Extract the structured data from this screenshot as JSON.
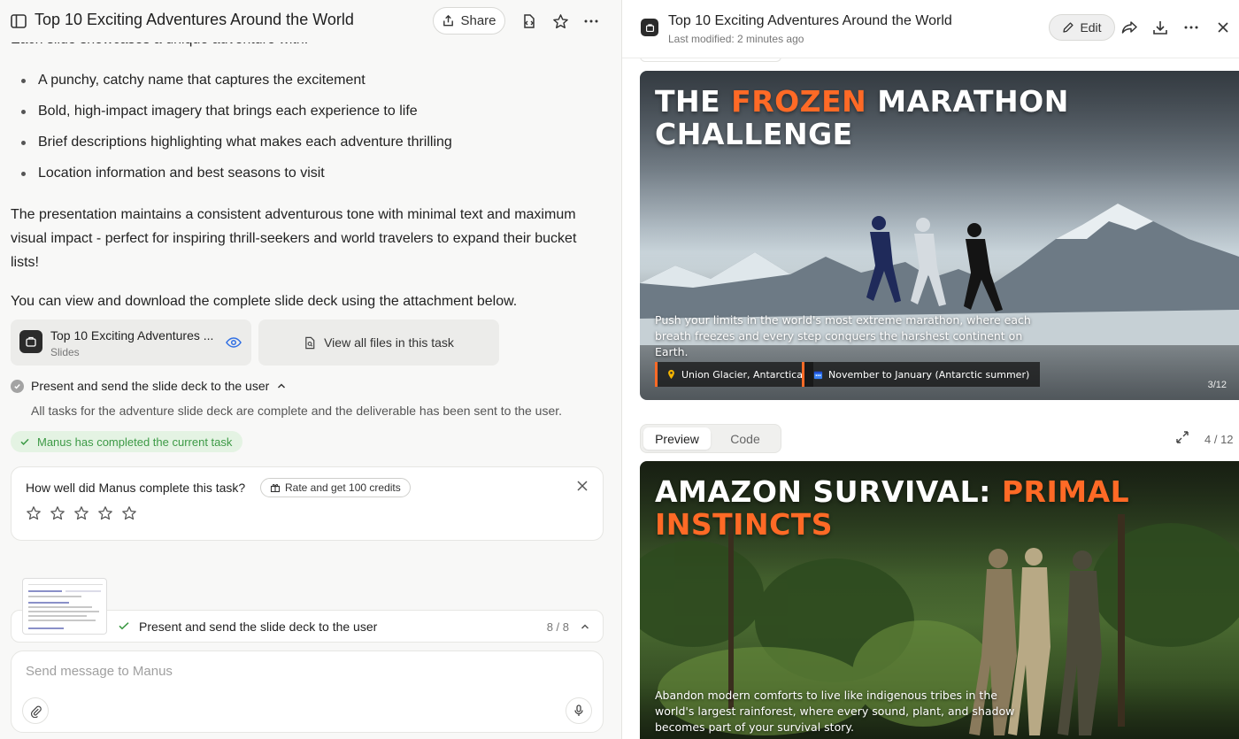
{
  "chat": {
    "title": "Top 10 Exciting Adventures Around the World",
    "share_label": "Share",
    "clipped_intro": "Each slide showcases a unique adventure with:",
    "bullets": [
      "A punchy, catchy name that captures the excitement",
      "Bold, high-impact imagery that brings each experience to life",
      "Brief descriptions highlighting what makes each adventure thrilling",
      "Location information and best seasons to visit"
    ],
    "paragraph_1": "The presentation maintains a consistent adventurous tone with minimal text and maximum visual impact - perfect for inspiring thrill-seekers and world travelers to expand their bucket lists!",
    "paragraph_2": "You can view and download the complete slide deck using the attachment below.",
    "attachment": {
      "name": "Top 10 Exciting Adventures ...",
      "type": "Slides"
    },
    "view_all_label": "View all files in this task",
    "task": {
      "title": "Present and send the slide deck to the user",
      "detail": "All tasks for the adventure slide deck are complete and the deliverable has been sent to the user."
    },
    "completed_label": "Manus has completed the current task",
    "rating": {
      "question": "How well did Manus complete this task?",
      "badge": "Rate and get 100 credits",
      "stars": 5
    },
    "progress": {
      "text": "Present and send the slide deck to the user",
      "count": "8 / 8"
    },
    "input": {
      "placeholder": "Send message to Manus"
    }
  },
  "viewer": {
    "title": "Top 10 Exciting Adventures Around the World",
    "subtitle": "Last modified: 2 minutes ago",
    "edit_label": "Edit",
    "tabs": [
      {
        "label": "Preview",
        "active": true
      },
      {
        "label": "Code",
        "active": false
      }
    ],
    "page_count": "4 / 12",
    "slide_a": {
      "title_prefix": "THE ",
      "title_accent": "FROZEN",
      "title_suffix": " MARATHON CHALLENGE",
      "description": "Push your limits in the world's most extreme marathon, where each breath freezes and every step conquers the harshest continent on Earth.",
      "location": "Union Glacier, Antarctica",
      "season": "November to January (Antarctic summer)",
      "counter": "3/12"
    },
    "slide_b": {
      "title_prefix": "AMAZON SURVIVAL: ",
      "title_accent": "PRIMAL INSTINCTS",
      "description": "Abandon modern comforts to live like indigenous tribes in the world's largest rainforest, where every sound, plant, and shadow becomes part of your survival story."
    }
  },
  "colors": {
    "accent": "#ff6a26",
    "success": "#3d9a46",
    "success_bg": "#e4f3e3"
  }
}
